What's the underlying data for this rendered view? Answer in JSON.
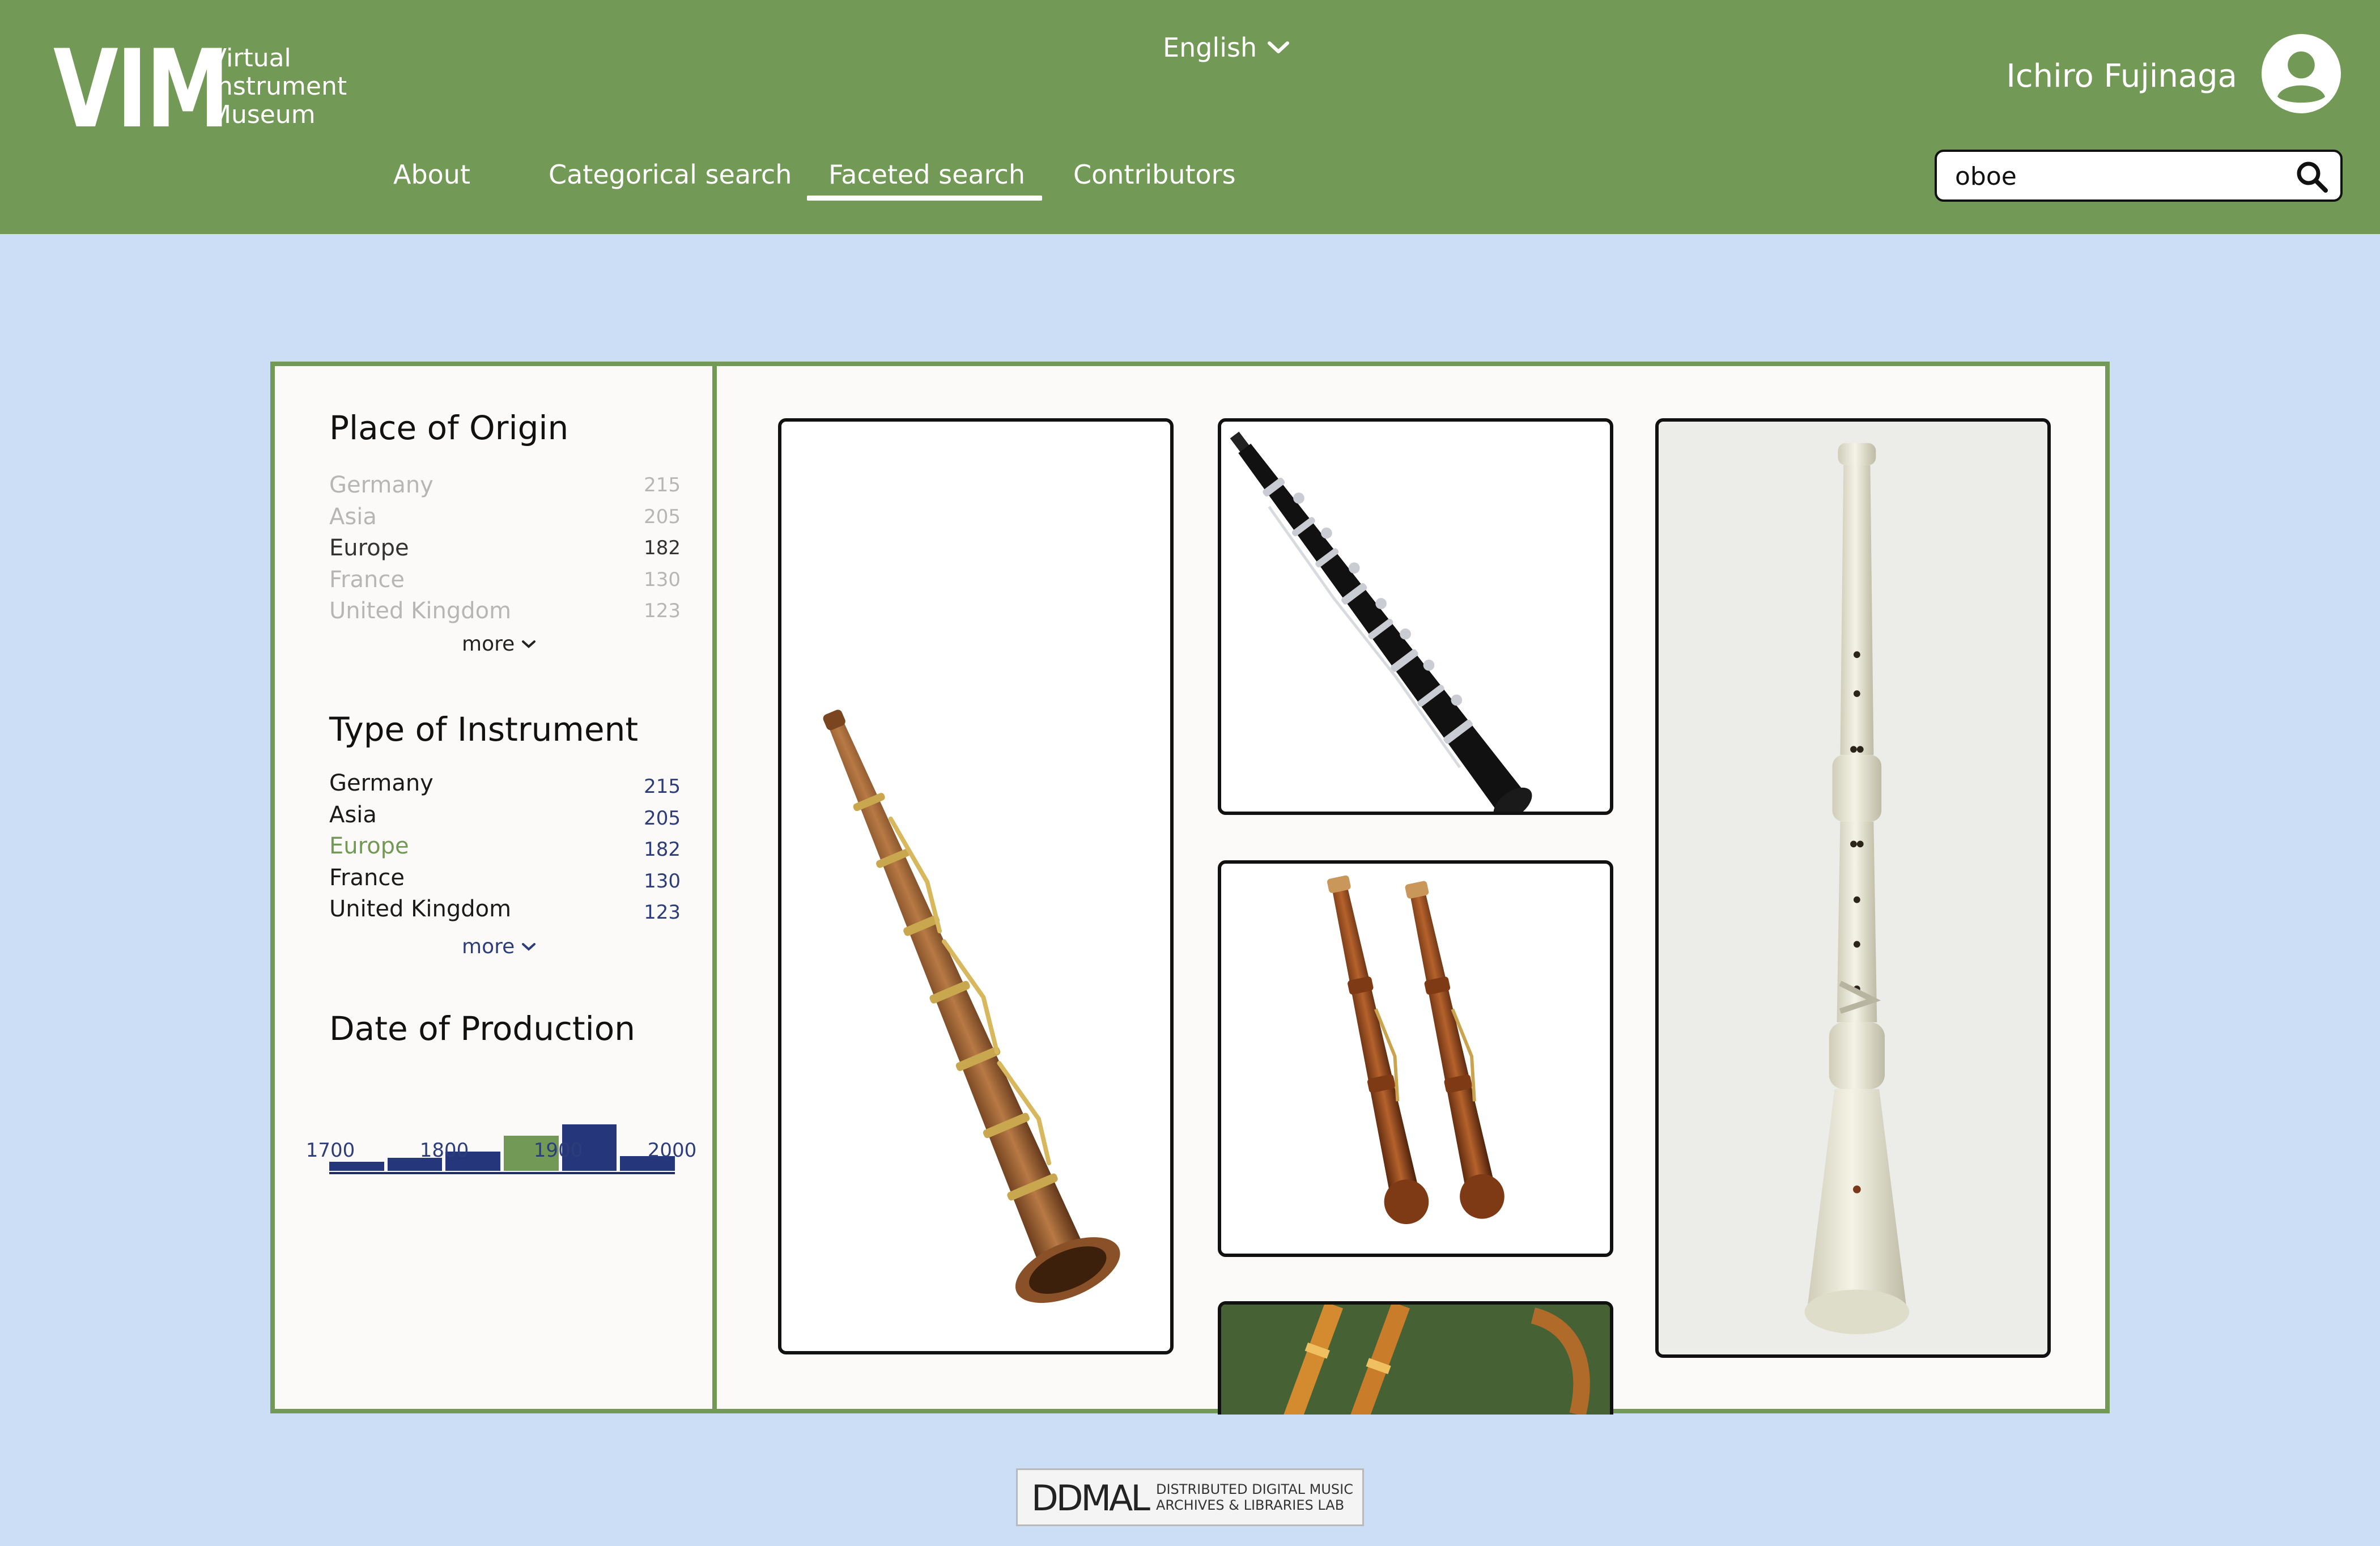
{
  "header": {
    "logo_mark": "VIM",
    "logo_text": "Virtual\nInstrument\nMuseum",
    "language": "English",
    "user_name": "Ichiro Fujinaga",
    "search_value": "oboe",
    "nav": [
      "About",
      "Categorical search",
      "Faceted search",
      "Contributors"
    ],
    "active_nav": "Faceted search"
  },
  "facets": {
    "origin": {
      "title": "Place of Origin",
      "items": [
        {
          "label": "Germany",
          "count": "215"
        },
        {
          "label": "Asia",
          "count": "205"
        },
        {
          "label": "Europe",
          "count": "182"
        },
        {
          "label": "France",
          "count": "130"
        },
        {
          "label": "United Kingdom",
          "count": "123"
        }
      ],
      "more": "more"
    },
    "type": {
      "title": "Type of Instrument",
      "items": [
        {
          "label": "Germany",
          "count": "215"
        },
        {
          "label": "Asia",
          "count": "205"
        },
        {
          "label": "Europe",
          "count": "182"
        },
        {
          "label": "France",
          "count": "130"
        },
        {
          "label": "United Kingdom",
          "count": "123"
        }
      ],
      "more": "more"
    },
    "date": {
      "title": "Date of Production",
      "ticks": [
        "1700",
        "1800",
        "1900",
        "2000"
      ]
    }
  },
  "chart_data": {
    "type": "bar",
    "categories": [
      "1700-1750",
      "1750-1800",
      "1800-1850",
      "1850-1900",
      "1900-1950",
      "1950-2000"
    ],
    "values": [
      1,
      1.4,
      2.1,
      3.8,
      5,
      1.6
    ],
    "highlight_index": 3,
    "colors": {
      "bar": "#25377a",
      "highlight": "#739956"
    }
  },
  "results": [
    {
      "name": "wooden-brass-keyed-oboe"
    },
    {
      "name": "black-modern-oboe"
    },
    {
      "name": "pair-of-baroque-oboes"
    },
    {
      "name": "ivory-oboe"
    },
    {
      "name": "oboe-painting"
    }
  ],
  "footer": {
    "logo_mark": "DDMAL",
    "logo_text": "DISTRIBUTED DIGITAL MUSIC\nARCHIVES & LIBRARIES LAB"
  },
  "colors": {
    "header_bg": "#739956",
    "page_bg": "#cbdef5",
    "panel_bg": "#fcfaf8",
    "count_blue": "#2c3d7a"
  }
}
